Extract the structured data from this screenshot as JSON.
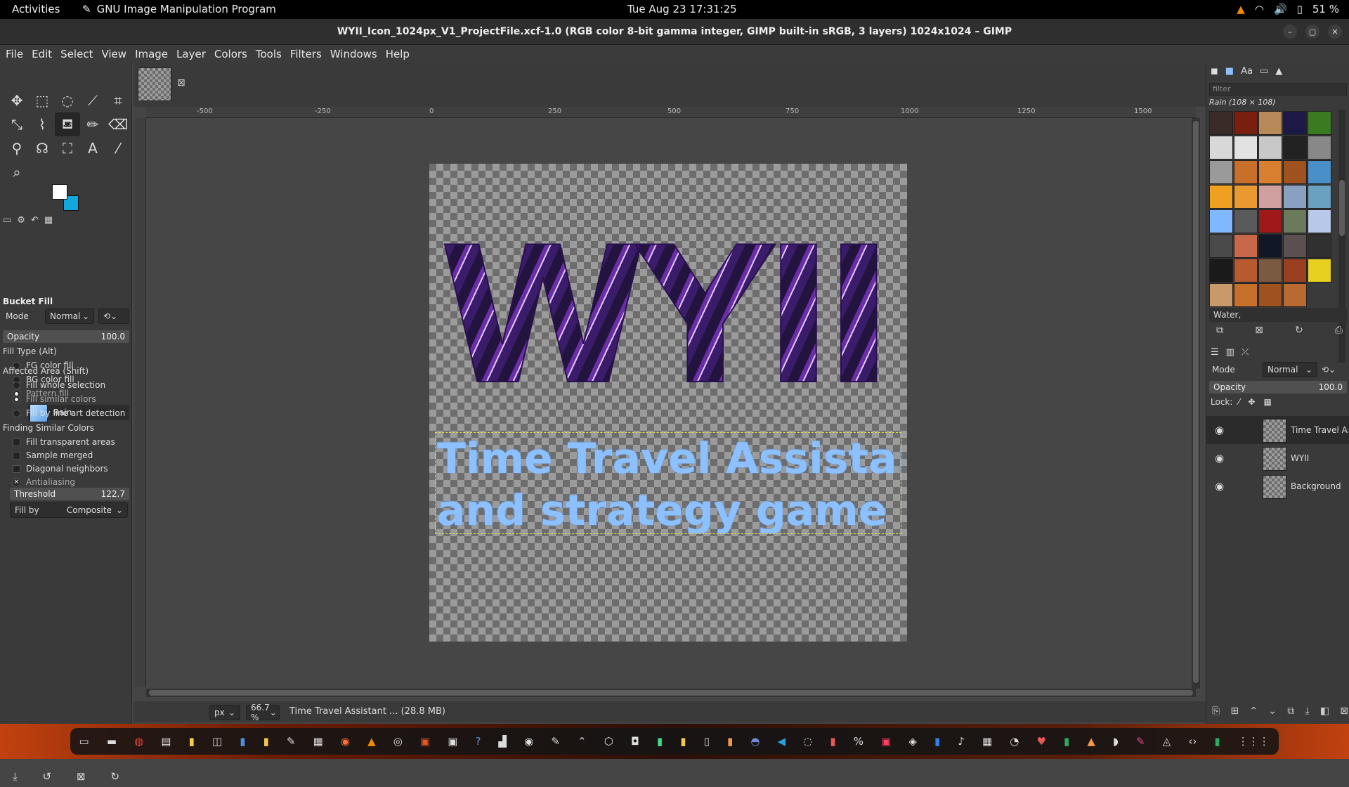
{
  "topbar": {
    "activities": "Activities",
    "app_name": "GNU Image Manipulation Program",
    "clock": "Tue Aug 23  17:31:25",
    "battery": "51 %"
  },
  "window": {
    "title": "WYII_Icon_1024px_V1_ProjectFile.xcf-1.0 (RGB color 8-bit gamma integer, GIMP built-in sRGB, 3 layers) 1024x1024 – GIMP"
  },
  "menu": [
    "File",
    "Edit",
    "Select",
    "View",
    "Image",
    "Layer",
    "Colors",
    "Tools",
    "Filters",
    "Windows",
    "Help"
  ],
  "colors": {
    "fg": "#ffffff",
    "bg": "#12a8dc"
  },
  "tool_options": {
    "title": "Bucket Fill",
    "mode_label": "Mode",
    "mode_value": "Normal",
    "opacity_label": "Opacity",
    "opacity_value": "100.0",
    "fill_type_label": "Fill Type  (Alt)",
    "fill_fg": "FG color fill",
    "fill_bg": "BG color fill",
    "fill_pattern": "Pattern fill",
    "pattern_name": "Rain",
    "affected_label": "Affected Area  (Shift)",
    "area_whole": "Fill whole selection",
    "area_similar": "Fill similar colors",
    "area_lineart": "Fill by line art detection",
    "finding_label": "Finding Similar Colors",
    "opt_transparent": "Fill transparent areas",
    "opt_merged": "Sample merged",
    "opt_diagonal": "Diagonal neighbors",
    "opt_antialias": "Antialiasing",
    "threshold_label": "Threshold",
    "threshold_value": "122.7",
    "fillby_label": "Fill by",
    "fillby_value": "Composite"
  },
  "ruler": {
    "ticks": [
      "-500",
      "-250",
      "0",
      "250",
      "500",
      "750",
      "1000",
      "1250",
      "1500"
    ]
  },
  "canvas": {
    "big_text": "WYII",
    "line1": "Time Travel Assistant",
    "line2": "and strategy game"
  },
  "status": {
    "unit": "px",
    "zoom": "66.7 %",
    "message": "Time Travel Assistant ... (28.8 MB)"
  },
  "patterns": {
    "filter_placeholder": "filter",
    "selected": "Rain (108 × 108)",
    "tag": "Water,",
    "swatches": [
      "#3a2a28",
      "#7a1e10",
      "#b88a5a",
      "#1e1a48",
      "#3a7a20",
      "#d8d8d8",
      "#e2e2e2",
      "#c8c8c8",
      "#222222",
      "#888888",
      "#9a9a9a",
      "#c8702a",
      "#d88030",
      "#a0521e",
      "#4a90c8",
      "#f0a020",
      "#e89a30",
      "#d0a0a0",
      "#8aa0c0",
      "#6aa0c0",
      "#7fb8ff",
      "#5a5a5a",
      "#a01818",
      "#6a7a5a",
      "#b8c8e8",
      "#4a4a4a",
      "#c86848",
      "#101828",
      "#5a5050",
      "#303030",
      "#1a1a1a",
      "#b85a30",
      "#7a5a40",
      "#9a4020",
      "#e8d020",
      "#c89a6a",
      "#c8702a",
      "#a0521e",
      "#b86a30"
    ]
  },
  "layers": {
    "mode_label": "Mode",
    "mode_value": "Normal",
    "opacity_label": "Opacity",
    "opacity_value": "100.0",
    "lock_label": "Lock:",
    "items": [
      "Time Travel As",
      "WYII",
      "Background"
    ]
  }
}
